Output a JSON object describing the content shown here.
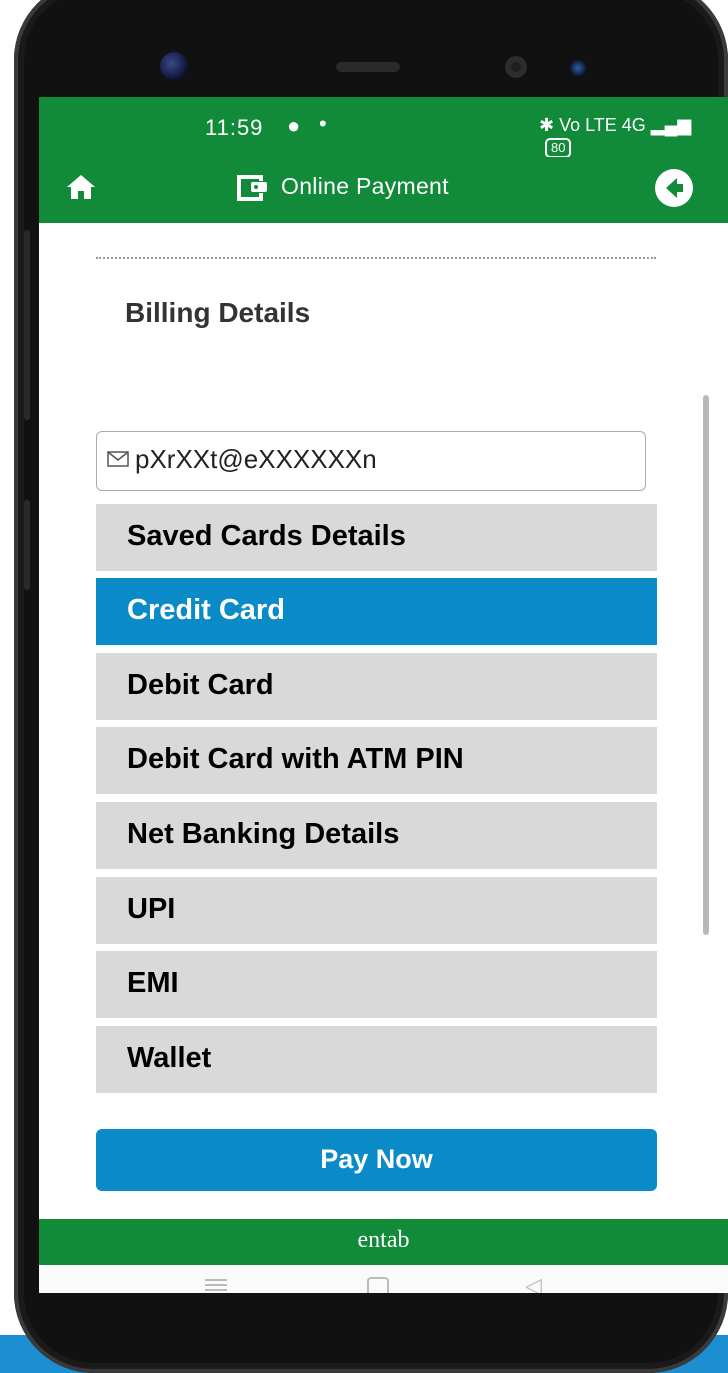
{
  "statusbar": {
    "time": "11:59",
    "call_icon": "●",
    "dot": "•",
    "icons": "✱ Vo LTE 4G ▂▄▆",
    "battery": "80"
  },
  "appbar": {
    "title": "Online Payment",
    "home_icon": "home-icon",
    "wallet_icon": "wallet-icon",
    "back_icon": "back-arrow-icon"
  },
  "billing": {
    "title": "Billing Details",
    "email": "pXrXXt@eXXXXXXn"
  },
  "payment_methods": [
    {
      "label": "Saved Cards Details",
      "active": false
    },
    {
      "label": "Credit Card",
      "active": true
    },
    {
      "label": "Debit Card",
      "active": false
    },
    {
      "label": "Debit Card with ATM PIN",
      "active": false
    },
    {
      "label": "Net Banking Details",
      "active": false
    },
    {
      "label": "UPI",
      "active": false
    },
    {
      "label": "EMI",
      "active": false
    },
    {
      "label": "Wallet",
      "active": false
    }
  ],
  "pay_button": {
    "label": "Pay Now"
  },
  "footer": {
    "brand": "entab"
  },
  "colors": {
    "green": "#118a3a",
    "blue": "#0a8bc8",
    "grey_item": "#d9d9d9"
  }
}
